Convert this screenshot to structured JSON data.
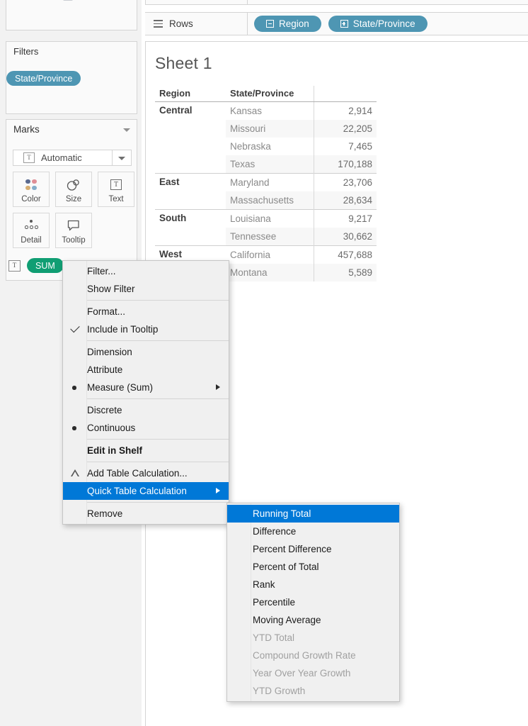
{
  "left_panel": {
    "filters": {
      "title": "Filters",
      "pills": [
        {
          "label": "State/Province",
          "type": "dimension"
        }
      ]
    },
    "marks": {
      "title": "Marks",
      "mark_type": "Automatic",
      "mark_type_icon": "text-box-icon",
      "buttons": [
        {
          "label": "Color",
          "icon": "color-dots-icon"
        },
        {
          "label": "Size",
          "icon": "size-circles-icon"
        },
        {
          "label": "Text",
          "icon": "text-box-icon"
        },
        {
          "label": "Detail",
          "icon": "detail-dots-icon"
        },
        {
          "label": "Tooltip",
          "icon": "tooltip-bubble-icon"
        }
      ],
      "card_pills": [
        {
          "label": "SUM",
          "type": "measure",
          "icon": "text-box-icon"
        }
      ]
    }
  },
  "shelves": {
    "rows": {
      "label": "Rows",
      "icon": "rows-list-icon",
      "pills": [
        {
          "label": "Region",
          "type": "dimension",
          "expander": "minus"
        },
        {
          "label": "State/Province",
          "type": "dimension",
          "expander": "plus"
        }
      ]
    }
  },
  "worksheet": {
    "title": "Sheet 1",
    "table": {
      "headers": [
        "Region",
        "State/Province",
        ""
      ],
      "rows": [
        {
          "region": "Central",
          "state": "Kansas",
          "value": "2,914",
          "group_start": true,
          "banded": false
        },
        {
          "region": "",
          "state": "Missouri",
          "value": "22,205",
          "group_start": false,
          "banded": true
        },
        {
          "region": "",
          "state": "Nebraska",
          "value": "7,465",
          "group_start": false,
          "banded": false
        },
        {
          "region": "",
          "state": "Texas",
          "value": "170,188",
          "group_start": false,
          "banded": true
        },
        {
          "region": "East",
          "state": "Maryland",
          "value": "23,706",
          "group_start": true,
          "banded": false
        },
        {
          "region": "",
          "state": "Massachusetts",
          "value": "28,634",
          "group_start": false,
          "banded": true
        },
        {
          "region": "South",
          "state": "Louisiana",
          "value": "9,217",
          "group_start": true,
          "banded": false
        },
        {
          "region": "",
          "state": "Tennessee",
          "value": "30,662",
          "group_start": false,
          "banded": true
        },
        {
          "region": "West",
          "state": "California",
          "value": "457,688",
          "group_start": true,
          "banded": false
        },
        {
          "region": "",
          "state": "Montana",
          "value": "5,589",
          "group_start": false,
          "banded": true
        }
      ]
    }
  },
  "context_menu": {
    "items": [
      {
        "label": "Filter...",
        "marker": "none",
        "arrow": false,
        "bold": false,
        "selected": false
      },
      {
        "label": "Show Filter",
        "marker": "none",
        "arrow": false,
        "bold": false,
        "selected": false
      },
      {
        "label": "Format...",
        "marker": "none",
        "arrow": false,
        "bold": false,
        "selected": false
      },
      {
        "label": "Include in Tooltip",
        "marker": "check",
        "arrow": false,
        "bold": false,
        "selected": false
      },
      {
        "label": "Dimension",
        "marker": "none",
        "arrow": false,
        "bold": false,
        "selected": false
      },
      {
        "label": "Attribute",
        "marker": "none",
        "arrow": false,
        "bold": false,
        "selected": false
      },
      {
        "label": "Measure (Sum)",
        "marker": "radio",
        "arrow": true,
        "bold": false,
        "selected": false
      },
      {
        "label": "Discrete",
        "marker": "none",
        "arrow": false,
        "bold": false,
        "selected": false
      },
      {
        "label": "Continuous",
        "marker": "radio",
        "arrow": false,
        "bold": false,
        "selected": false
      },
      {
        "label": "Edit in Shelf",
        "marker": "none",
        "arrow": false,
        "bold": true,
        "selected": false
      },
      {
        "label": "Add Table Calculation...",
        "marker": "triangle",
        "arrow": false,
        "bold": false,
        "selected": false
      },
      {
        "label": "Quick Table Calculation",
        "marker": "none",
        "arrow": true,
        "bold": false,
        "selected": true
      },
      {
        "label": "Remove",
        "marker": "none",
        "arrow": false,
        "bold": false,
        "selected": false
      }
    ]
  },
  "submenu": {
    "items": [
      {
        "label": "Running Total",
        "disabled": false,
        "selected": true
      },
      {
        "label": "Difference",
        "disabled": false,
        "selected": false
      },
      {
        "label": "Percent Difference",
        "disabled": false,
        "selected": false
      },
      {
        "label": "Percent of Total",
        "disabled": false,
        "selected": false
      },
      {
        "label": "Rank",
        "disabled": false,
        "selected": false
      },
      {
        "label": "Percentile",
        "disabled": false,
        "selected": false
      },
      {
        "label": "Moving Average",
        "disabled": false,
        "selected": false
      },
      {
        "label": "YTD Total",
        "disabled": true,
        "selected": false
      },
      {
        "label": "Compound Growth Rate",
        "disabled": true,
        "selected": false
      },
      {
        "label": "Year Over Year Growth",
        "disabled": true,
        "selected": false
      },
      {
        "label": "YTD Growth",
        "disabled": true,
        "selected": false
      }
    ]
  },
  "colors": {
    "dimension_pill": "#4e96b3",
    "measure_pill": "#109e73",
    "menu_highlight": "#0078d7",
    "panel_bg": "#f2f2f2",
    "menu_bg": "#f0f0f0"
  }
}
